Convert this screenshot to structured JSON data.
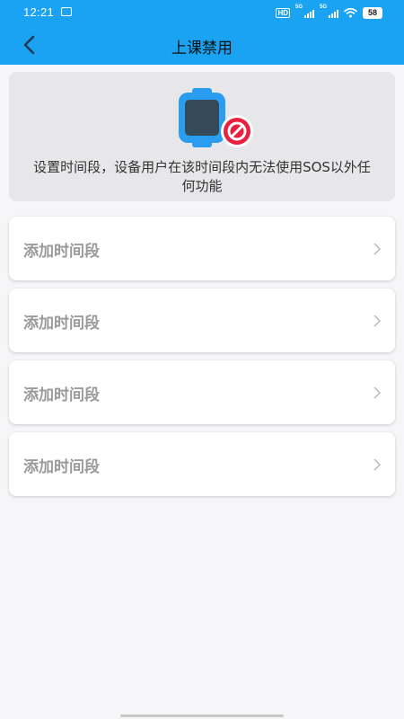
{
  "status_bar": {
    "time": "12:21",
    "hd_label": "HD",
    "signal_1_label": "5G",
    "signal_2_label": "5G",
    "battery": "58",
    "icons": [
      "app-notification-icon",
      "hd-icon",
      "signal-icon",
      "signal-icon",
      "wifi-icon",
      "battery-icon"
    ]
  },
  "nav": {
    "title": "上课禁用",
    "back_icon": "back-arrow-icon"
  },
  "banner": {
    "illustration": "watch-disabled-icon",
    "text": "设置时间段，设备用户在该时间段内无法使用SOS以外任何功能"
  },
  "time_slots": [
    {
      "label": "添加时间段"
    },
    {
      "label": "添加时间段"
    },
    {
      "label": "添加时间段"
    },
    {
      "label": "添加时间段"
    }
  ],
  "colors": {
    "header": "#1aa3f2",
    "banner_bg": "#e7e7ea",
    "page_bg": "#f6f6f8",
    "forbidden": "#e8223e",
    "watch_frame": "#2a9df0"
  }
}
